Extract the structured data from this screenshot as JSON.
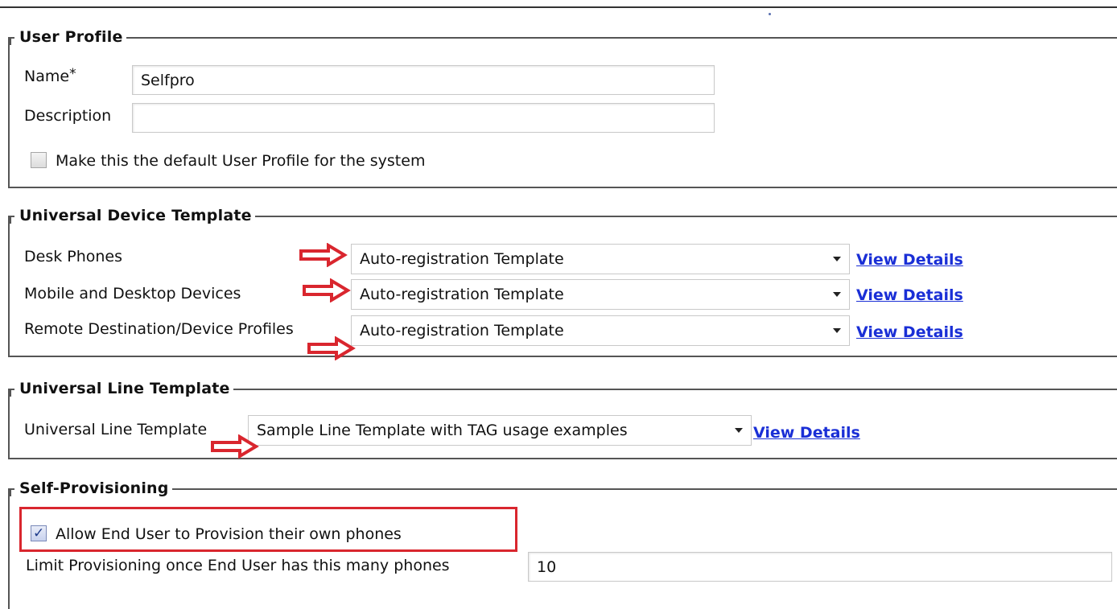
{
  "user_profile": {
    "legend": "User Profile",
    "name_label": "Name",
    "required_marker": "*",
    "name_value": "Selfpro",
    "description_label": "Description",
    "description_value": "",
    "default_checkbox_label": "Make this the default User Profile for the system",
    "default_checked": false
  },
  "universal_device_template": {
    "legend": "Universal Device Template",
    "rows": [
      {
        "label": "Desk Phones",
        "value": "Auto-registration Template",
        "link": "View Details"
      },
      {
        "label": "Mobile and Desktop Devices",
        "value": "Auto-registration Template",
        "link": "View Details"
      },
      {
        "label": "Remote Destination/Device Profiles",
        "value": "Auto-registration Template",
        "link": "View Details"
      }
    ]
  },
  "universal_line_template": {
    "legend": "Universal Line Template",
    "label": "Universal Line Template",
    "value": "Sample Line Template with TAG usage examples",
    "link": "View Details"
  },
  "self_provisioning": {
    "legend": "Self-Provisioning",
    "allow_label": "Allow End User to Provision their own phones",
    "allow_checked": true,
    "limit_label": "Limit Provisioning once End User has this many phones",
    "limit_value": "10"
  },
  "colors": {
    "link": "#1a2fd6",
    "annotation_red": "#d9262e"
  },
  "icons": {
    "annotation": "right-arrow-icon",
    "dropdown": "chevron-down-icon"
  }
}
